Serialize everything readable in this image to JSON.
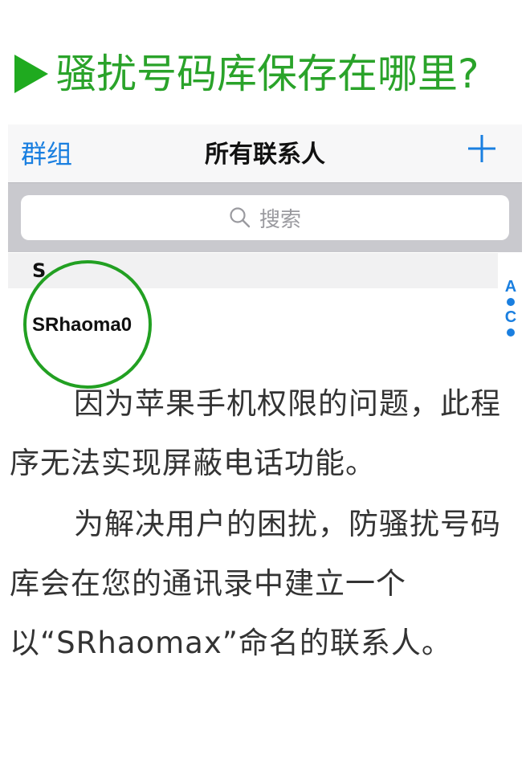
{
  "heading": {
    "text": "骚扰号码库保存在哪里?",
    "color": "#2aa32a",
    "icon": "play-icon"
  },
  "contacts_app": {
    "nav_left": "群组",
    "nav_title": "所有联系人",
    "nav_right_icon": "plus-icon",
    "search_placeholder": "搜索",
    "section_letter": "S",
    "contact_name": "SRhaoma0",
    "index_letters": [
      "A",
      "C"
    ],
    "accent": "#1a7fe0"
  },
  "paragraphs": [
    "因为苹果手机权限的问题，此程序无法实现屏蔽电话功能。",
    "为解决用户的困扰，防骚扰号码库会在您的通讯录中建立一个以“SRhaomax”命名的联系人。"
  ]
}
